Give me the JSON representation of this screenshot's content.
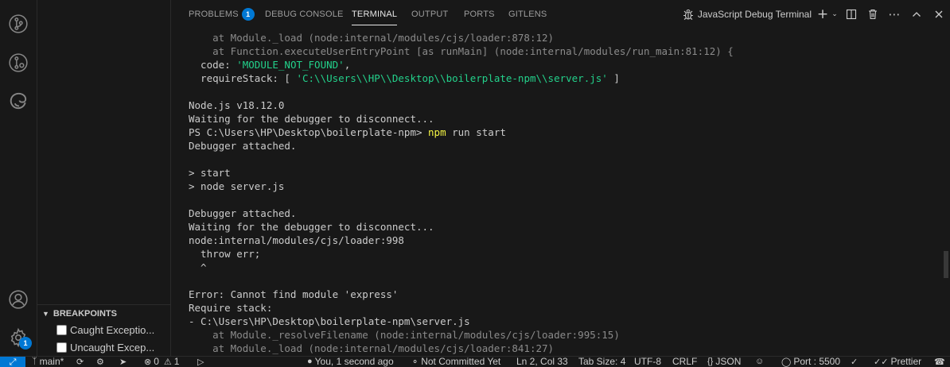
{
  "activity_bar": {
    "settings_badge": "1"
  },
  "breakpoints": {
    "header": "BREAKPOINTS",
    "items": [
      {
        "label": "Caught Exceptio..."
      },
      {
        "label": "Uncaught Excep..."
      }
    ]
  },
  "panel": {
    "tabs": [
      {
        "label": "PROBLEMS",
        "badge": "1"
      },
      {
        "label": "DEBUG CONSOLE"
      },
      {
        "label": "TERMINAL"
      },
      {
        "label": "OUTPUT"
      },
      {
        "label": "PORTS"
      },
      {
        "label": "GITLENS"
      }
    ],
    "terminal_name": "JavaScript Debug Terminal"
  },
  "terminal": {
    "lines": [
      "    at Module._load (node:internal/modules/cjs/loader:878:12)",
      "    at Function.executeUserEntryPoint [as runMain] (node:internal/modules/run_main:81:12) {",
      "  code: ",
      "'MODULE_NOT_FOUND'",
      ",",
      "  requireStack: [ ",
      "'C:\\\\Users\\\\HP\\\\Desktop\\\\boilerplate-npm\\\\server.js'",
      " ]",
      "Node.js v18.12.0",
      "Waiting for the debugger to disconnect...",
      "PS C:\\Users\\HP\\Desktop\\boilerplate-npm> ",
      "npm",
      " run start",
      "Debugger attached.",
      "> start",
      "> node server.js",
      "Debugger attached.",
      "Waiting for the debugger to disconnect...",
      "node:internal/modules/cjs/loader:998",
      "  throw err;",
      "  ^",
      "Error: Cannot find module 'express'",
      "Require stack:",
      "- C:\\Users\\HP\\Desktop\\boilerplate-npm\\server.js",
      "    at Module._resolveFilename (node:internal/modules/cjs/loader:995:15)",
      "    at Module._load (node:internal/modules/cjs/loader:841:27)"
    ]
  },
  "status_bar": {
    "branch": "main*",
    "errors": "0",
    "warnings": "1",
    "blame": "You, 1 second ago",
    "commit": "Not Committed Yet",
    "cursor": "Ln 2, Col 33",
    "tab_size": "Tab Size: 4",
    "encoding": "UTF-8",
    "eol": "CRLF",
    "language": "JSON",
    "port": "Port : 5500",
    "formatter": "Prettier"
  },
  "colors": {
    "accent": "#0078d4",
    "string": "#23d18b",
    "command": "#f5f543",
    "error": "#f14c4c",
    "background": "#181818"
  }
}
